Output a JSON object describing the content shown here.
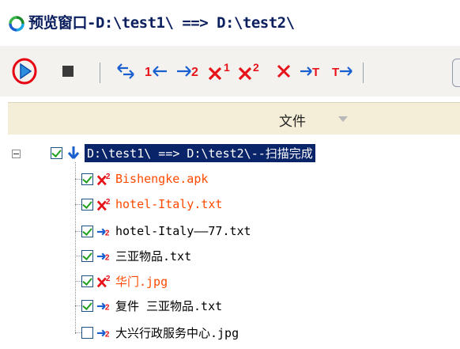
{
  "window": {
    "title": "预览窗口-D:\\test1\\ ==> D:\\test2\\",
    "icon": "refresh-app-icon"
  },
  "toolbar": {
    "buttons": [
      {
        "name": "play-button",
        "icon": "play-icon",
        "highlighted": true
      },
      {
        "name": "stop-button",
        "icon": "stop-icon"
      },
      {
        "name": "sync-both-button",
        "icon": "sync-arrows-icon"
      },
      {
        "name": "copy-to-1-button",
        "icon": "arrow-left-1-icon",
        "text": "1"
      },
      {
        "name": "copy-to-2-button",
        "icon": "arrow-right-2-icon",
        "text": "2"
      },
      {
        "name": "delete-1-button",
        "icon": "x-1-icon",
        "text": "1"
      },
      {
        "name": "delete-2-button",
        "icon": "x-2-icon",
        "text": "2"
      },
      {
        "name": "delete-button",
        "icon": "x-icon"
      },
      {
        "name": "move-top-button",
        "icon": "arrow-top-icon",
        "text": "T"
      },
      {
        "name": "move-bottom-button",
        "icon": "arrow-bottom-icon",
        "text": "T"
      }
    ]
  },
  "column_header": {
    "label": "文件",
    "sort_icon": "sort-down-icon"
  },
  "tree": {
    "root": {
      "label": "D:\\test1\\ ==> D:\\test2\\--扫描完成",
      "checked": true,
      "expanded": true,
      "icon": "down-arrow-icon"
    },
    "items": [
      {
        "label": "Bishengke.apk",
        "checked": true,
        "action": "x2",
        "color": "#ff4a00"
      },
      {
        "label": "hotel-Italy.txt",
        "checked": true,
        "action": "x2",
        "color": "#ff4a00"
      },
      {
        "label": "hotel-Italy——77.txt",
        "checked": true,
        "action": "to2",
        "color": "#000000"
      },
      {
        "label": "三亚物品.txt",
        "checked": true,
        "action": "to2",
        "color": "#000000"
      },
      {
        "label": "华门.jpg",
        "checked": true,
        "action": "x2",
        "color": "#ff4a00"
      },
      {
        "label": "复件 三亚物品.txt",
        "checked": true,
        "action": "to2",
        "color": "#000000"
      },
      {
        "label": "大兴行政服务中心.jpg",
        "checked": false,
        "action": "to2",
        "color": "#000000"
      }
    ]
  },
  "colors": {
    "accent_blue": "#1a5fd0",
    "delete_red": "#e8121a",
    "highlight_red": "#e60012",
    "selection_bg": "#0a246a"
  }
}
